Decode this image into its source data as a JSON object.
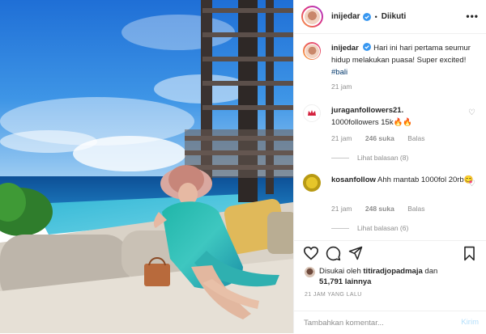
{
  "header": {
    "username": "inijedar",
    "follow_label": "Diikuti",
    "separator": "•",
    "more_icon": "more-horizontal-icon"
  },
  "caption": {
    "username": "inijedar",
    "text": "Hari ini hari pertama seumur hidup melakukan puasa! Super excited! ",
    "hashtag": "#bali",
    "time": "21 jam"
  },
  "comments": [
    {
      "username": "juraganfollowers21.",
      "text": "1000followers 15k🔥🔥",
      "time": "21 jam",
      "likes": "246 suka",
      "reply_label": "Balas",
      "view_replies": "Lihat balasan (8)"
    },
    {
      "username": "kosanfollow",
      "text": "Ahh mantab 1000fol 20rb😋",
      "time": "21 jam",
      "likes": "248 suka",
      "reply_label": "Balas",
      "view_replies": "Lihat balasan (6)"
    }
  ],
  "actions": {
    "liked_by_prefix": "Disukai oleh ",
    "liked_by_user": "titiradjopadmaja",
    "liked_by_and": " dan",
    "likes_count": "51,791",
    "likes_suffix": " lainnya",
    "timestamp": "21 JAM YANG LALU"
  },
  "add_comment": {
    "placeholder": "Tambahkan komentar...",
    "send_label": "Kirim"
  },
  "colors": {
    "verified": "#3897f0",
    "link": "#00376b",
    "muted": "#8e8e8e",
    "send_disabled": "#b2dffc"
  }
}
